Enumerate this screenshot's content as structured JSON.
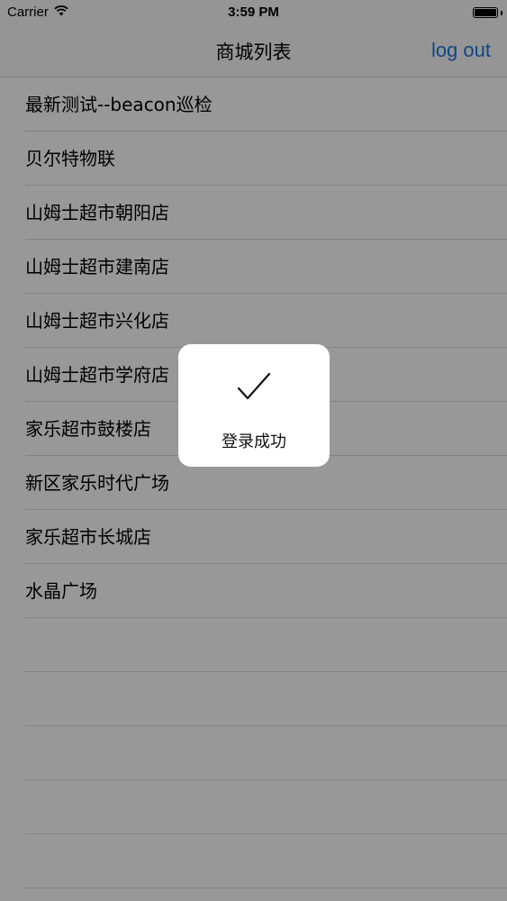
{
  "status_bar": {
    "carrier": "Carrier",
    "time": "3:59 PM",
    "battery_level": 1.0
  },
  "nav": {
    "title": "商城列表",
    "logout_label": "log out"
  },
  "stores": [
    {
      "name": "最新测试--beacon巡检"
    },
    {
      "name": "贝尔特物联"
    },
    {
      "name": "山姆士超市朝阳店"
    },
    {
      "name": "山姆士超市建南店"
    },
    {
      "name": "山姆士超市兴化店"
    },
    {
      "name": "山姆士超市学府店"
    },
    {
      "name": "家乐超市鼓楼店"
    },
    {
      "name": "新区家乐时代广场"
    },
    {
      "name": "家乐超市长城店"
    },
    {
      "name": "水晶广场"
    }
  ],
  "toast": {
    "icon": "checkmark-icon",
    "message": "登录成功"
  },
  "colors": {
    "accent": "#1c74d9",
    "overlay": "rgba(0,0,0,0.4)"
  }
}
